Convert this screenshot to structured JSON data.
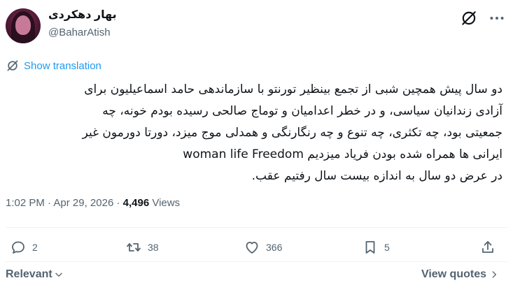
{
  "author": {
    "display_name": "بهار دهکردی",
    "handle": "@BaharAtish"
  },
  "header_icons": [
    "grok-icon",
    "more-options-icon"
  ],
  "translate": {
    "label": "Show translation"
  },
  "tweet": {
    "lines": [
      "دو سال پیش همچین شبی از تجمع بینظیر تورنتو با سازماندهی حامد اسماعیلیون برای",
      "آزادی زندانیان سیاسی، و در خطر اعدامیان و توماج صالحی رسیده بودم خونه، چه",
      "جمعیتی بود، چه تکثری، چه تنوع و چه رنگارنگی و همدلی موج میزد، دورتا دورمون غیر",
      "ایرانی ها همراه شده بودن فریاد میزدیم woman life Freedom",
      "در عرض دو سال به اندازه بیست سال رفتیم عقب."
    ]
  },
  "meta": {
    "time": "1:02 PM",
    "date": "Apr 29, 2026",
    "views_count": "4,496",
    "views_label": "Views",
    "separator": "·"
  },
  "actions": {
    "replies": "2",
    "reposts": "38",
    "likes": "366",
    "bookmarks": "5"
  },
  "footer": {
    "sort_label": "Relevant",
    "view_quotes_label": "View quotes"
  },
  "colors": {
    "accent": "#1d9bf0",
    "muted": "#536471",
    "text": "#0f1419",
    "divider": "#eff3f4"
  }
}
